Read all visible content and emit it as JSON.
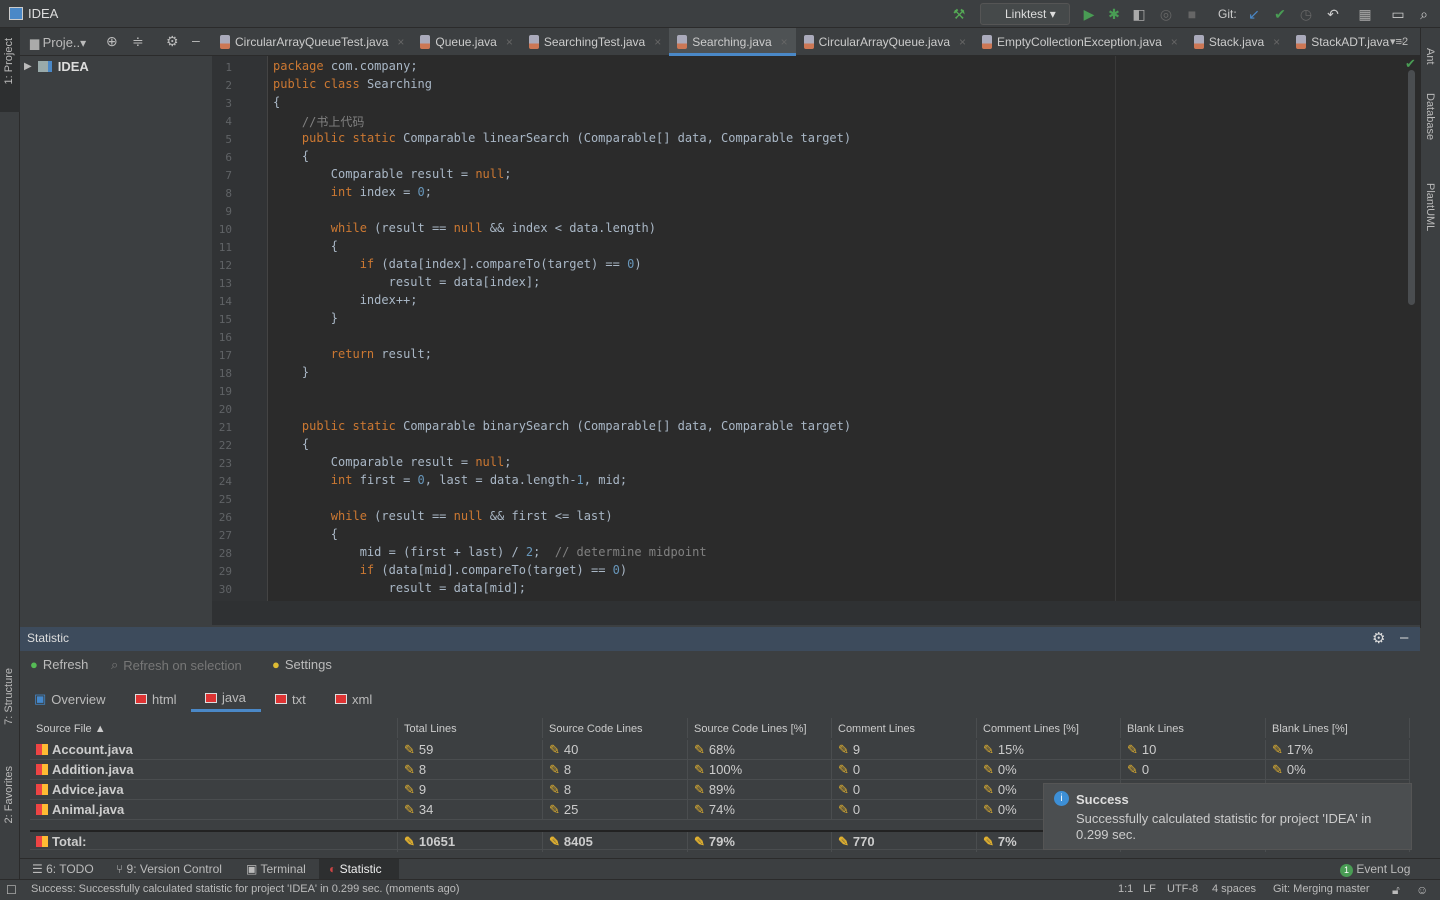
{
  "window": {
    "title": "IDEA"
  },
  "toolbar": {
    "run_config": "Linktest",
    "git_label": "Git:"
  },
  "project": {
    "header": "Proje..",
    "root": "IDEA"
  },
  "left_strip": {
    "project": "1: Project",
    "structure": "7: Structure",
    "favorites": "2: Favorites"
  },
  "right_strip": {
    "ant": "Ant",
    "database": "Database",
    "plantuml": "PlantUML"
  },
  "tabs": [
    {
      "label": "CircularArrayQueueTest.java"
    },
    {
      "label": "Queue.java"
    },
    {
      "label": "SearchingTest.java"
    },
    {
      "label": "Searching.java",
      "active": true
    },
    {
      "label": "CircularArrayQueue.java"
    },
    {
      "label": "EmptyCollectionException.java"
    },
    {
      "label": "Stack.java"
    },
    {
      "label": "StackADT.java"
    }
  ],
  "tabs_overflow": "2",
  "code": [
    "package com.company;",
    "public class Searching",
    "{",
    "    //书上代码",
    "    public static Comparable linearSearch (Comparable[] data, Comparable target)",
    "    {",
    "        Comparable result = null;",
    "        int index = 0;",
    "",
    "        while (result == null && index < data.length)",
    "        {",
    "            if (data[index].compareTo(target) == 0)",
    "                result = data[index];",
    "            index++;",
    "        }",
    "",
    "        return result;",
    "    }",
    "",
    "",
    "    public static Comparable binarySearch (Comparable[] data, Comparable target)",
    "    {",
    "        Comparable result = null;",
    "        int first = 0, last = data.length-1, mid;",
    "",
    "        while (result == null && first <= last)",
    "        {",
    "            mid = (first + last) / 2;  // determine midpoint",
    "            if (data[mid].compareTo(target) == 0)",
    "                result = data[mid];"
  ],
  "statistic": {
    "title": "Statistic",
    "refresh": "Refresh",
    "refresh_on_selection": "Refresh on selection",
    "settings": "Settings",
    "tabs": [
      "Overview",
      "html",
      "java",
      "txt",
      "xml"
    ],
    "active_tab": "java",
    "columns": [
      "Source File",
      "Total Lines",
      "Source Code Lines",
      "Source Code Lines [%]",
      "Comment Lines",
      "Comment Lines [%]",
      "Blank Lines",
      "Blank Lines [%]"
    ],
    "rows": [
      [
        "Account.java",
        "59",
        "40",
        "68%",
        "9",
        "15%",
        "10",
        "17%"
      ],
      [
        "Addition.java",
        "8",
        "8",
        "100%",
        "0",
        "0%",
        "0",
        "0%"
      ],
      [
        "Advice.java",
        "9",
        "8",
        "89%",
        "0",
        "0%",
        "",
        ""
      ],
      [
        "Animal.java",
        "34",
        "25",
        "74%",
        "0",
        "0%",
        "",
        ""
      ]
    ],
    "total": [
      "Total:",
      "10651",
      "8405",
      "79%",
      "770",
      "7%",
      "",
      ""
    ]
  },
  "notification": {
    "title": "Success",
    "body": "Successfully calculated statistic for project 'IDEA' in 0.299 sec."
  },
  "bottom_tools": {
    "todo": "6: TODO",
    "vcs": "9: Version Control",
    "terminal": "Terminal",
    "statistic": "Statistic",
    "event_log": "Event Log",
    "event_count": "1"
  },
  "status": {
    "message": "Success: Successfully calculated statistic for project 'IDEA' in 0.299 sec. (moments ago)",
    "position": "1:1",
    "line_sep": "LF",
    "encoding": "UTF-8",
    "indent": "4 spaces",
    "git": "Git: Merging master"
  }
}
